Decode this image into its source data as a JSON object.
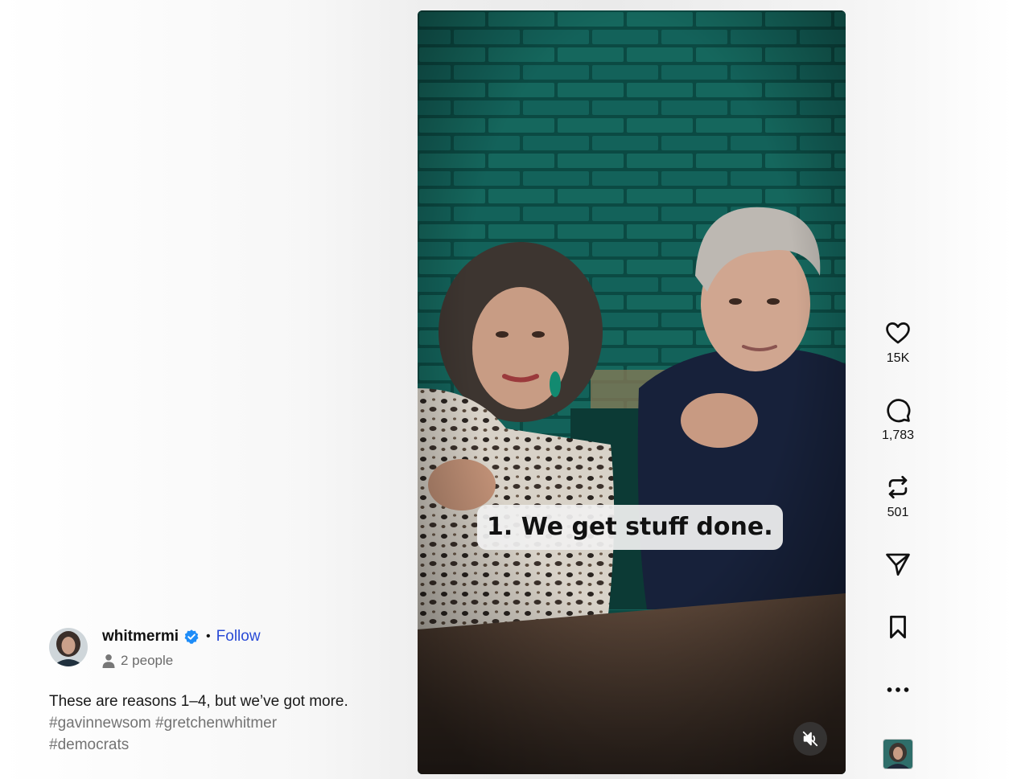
{
  "video": {
    "caption": "1. We get stuff done.",
    "muted": true
  },
  "actions": {
    "likes": "15K",
    "comments": "1,783",
    "reposts": "501"
  },
  "author": {
    "username": "whitmermi",
    "verified": true,
    "separator": "•",
    "follow_label": "Follow",
    "tagged_people": "2 people"
  },
  "post": {
    "caption": "These are reasons 1–4, but we’ve got more.",
    "hashtags": [
      "#gavinnewsom",
      "#gretchenwhitmer",
      "#democrats"
    ]
  },
  "colors": {
    "follow": "#2a4bd6",
    "verified_badge": "#1d8cf8",
    "hashtag": "#737373",
    "brick_wall": "#0f5a52"
  },
  "icons": {
    "like": "heart-icon",
    "comment": "comment-icon",
    "repost": "repost-icon",
    "share": "send-icon",
    "save": "bookmark-icon",
    "more": "more-icon",
    "mute": "speaker-muted-icon",
    "people": "person-icon"
  }
}
